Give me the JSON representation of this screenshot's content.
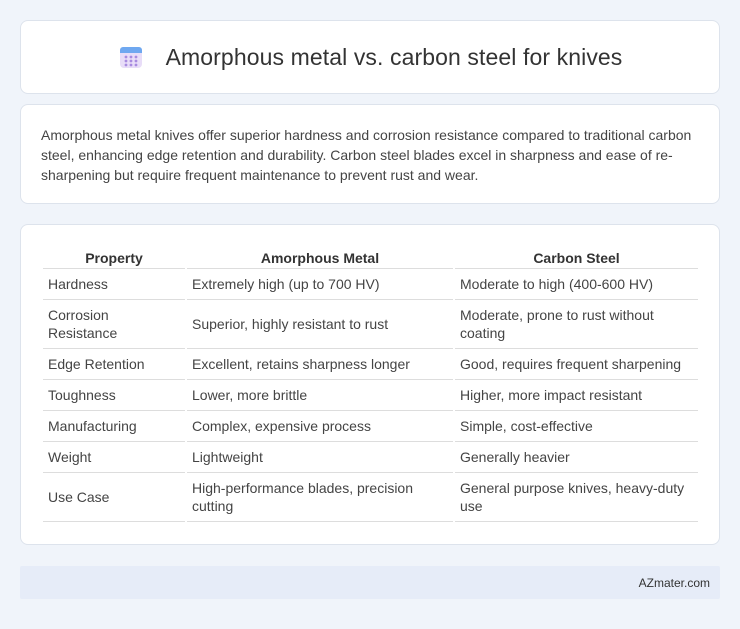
{
  "header": {
    "icon": "calendar-icon",
    "title": "Amorphous metal vs. carbon steel for knives",
    "icon_colors": {
      "top": "#6fa8f0",
      "body": "#e8ddf8",
      "dots": "#a88be0"
    }
  },
  "summary": {
    "text": "Amorphous metal knives offer superior hardness and corrosion resistance compared to traditional carbon steel, enhancing edge retention and durability. Carbon steel blades excel in sharpness and ease of re-sharpening but require frequent maintenance to prevent rust and wear."
  },
  "table": {
    "headers": [
      "Property",
      "Amorphous Metal",
      "Carbon Steel"
    ],
    "rows": [
      [
        "Hardness",
        "Extremely high (up to 700 HV)",
        "Moderate to high (400-600 HV)"
      ],
      [
        "Corrosion Resistance",
        "Superior, highly resistant to rust",
        "Moderate, prone to rust without coating"
      ],
      [
        "Edge Retention",
        "Excellent, retains sharpness longer",
        "Good, requires frequent sharpening"
      ],
      [
        "Toughness",
        "Lower, more brittle",
        "Higher, more impact resistant"
      ],
      [
        "Manufacturing",
        "Complex, expensive process",
        "Simple, cost-effective"
      ],
      [
        "Weight",
        "Lightweight",
        "Generally heavier"
      ],
      [
        "Use Case",
        "High-performance blades, precision cutting",
        "General purpose knives, heavy-duty use"
      ]
    ]
  },
  "footer": {
    "text": "AZmater.com"
  }
}
